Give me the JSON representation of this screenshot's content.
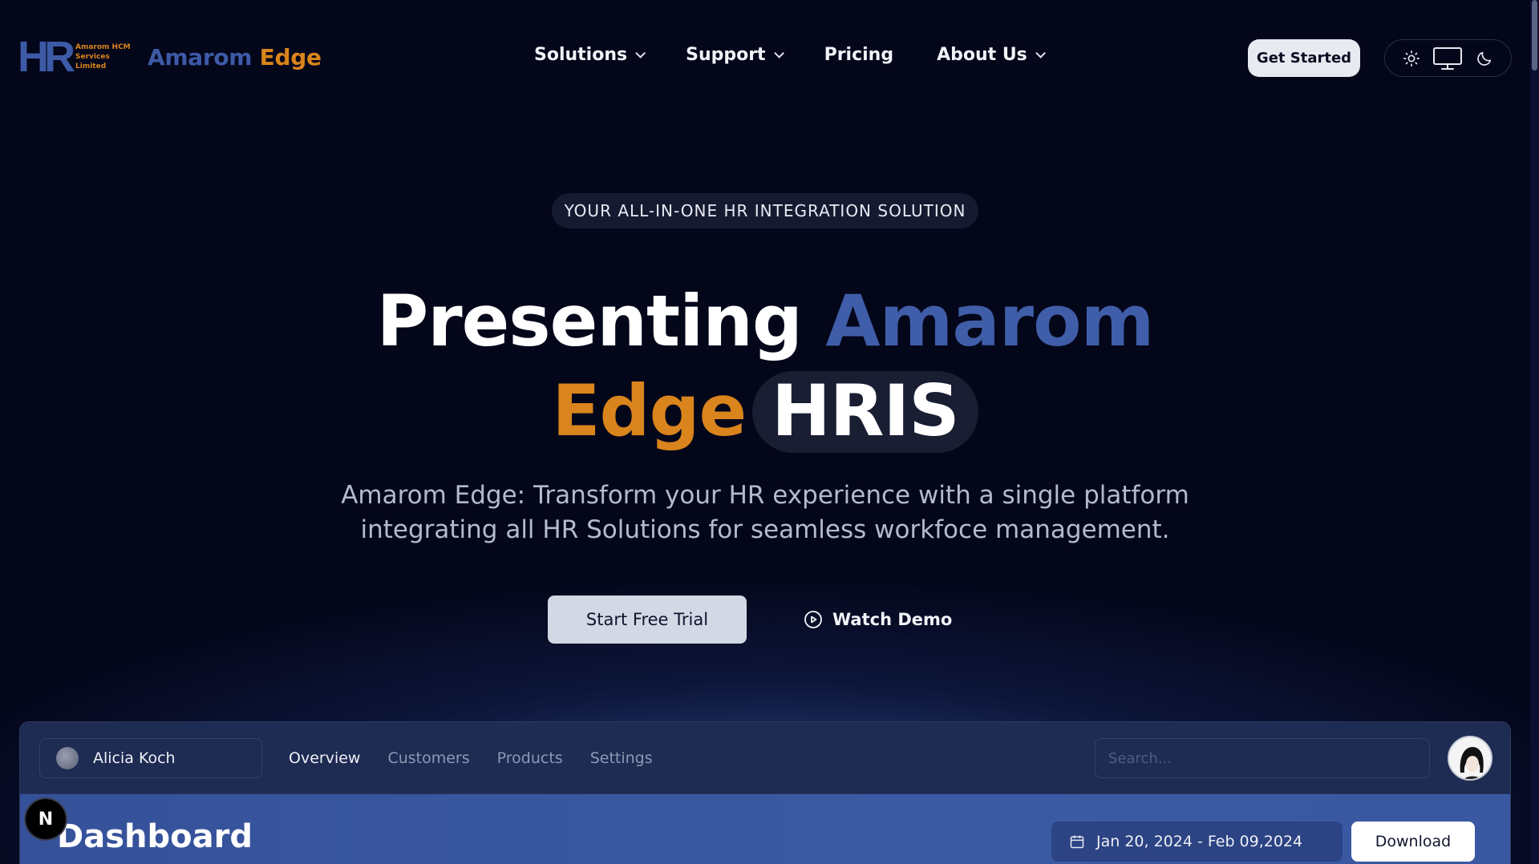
{
  "brand": {
    "mark": "HR",
    "mark_sub": "Amarom HCM Services Limited",
    "name_primary": "Amarom",
    "name_accent": "Edge"
  },
  "nav": {
    "items": [
      {
        "label": "Solutions",
        "has_dropdown": true
      },
      {
        "label": "Support",
        "has_dropdown": true
      },
      {
        "label": "Pricing",
        "has_dropdown": false
      },
      {
        "label": "About Us",
        "has_dropdown": true
      }
    ],
    "cta": "Get Started",
    "theme_options": [
      "sun-icon",
      "monitor-icon",
      "moon-icon"
    ]
  },
  "hero": {
    "eyebrow": "YOUR ALL-IN-ONE HR INTEGRATION SOLUTION",
    "headline_1": "Presenting",
    "headline_2": "Amarom",
    "headline_3": "Edge",
    "headline_4": "HRIS",
    "subtitle": "Amarom Edge: Transform your HR experience with a single platform integrating all HR Solutions for seamless workfoce management.",
    "primary_cta": "Start Free Trial",
    "secondary_cta": "Watch Demo"
  },
  "preview": {
    "team": "Alicia Koch",
    "tabs": [
      "Overview",
      "Customers",
      "Products",
      "Settings"
    ],
    "active_tab": "Overview",
    "search_placeholder": "Search...",
    "title": "Dashboard",
    "date_range": "Jan 20, 2024 - Feb 09,2024",
    "download": "Download"
  },
  "badge": "N",
  "colors": {
    "background": "#04061a",
    "brand_blue": "#3f5da8",
    "brand_orange": "#d9841c"
  }
}
